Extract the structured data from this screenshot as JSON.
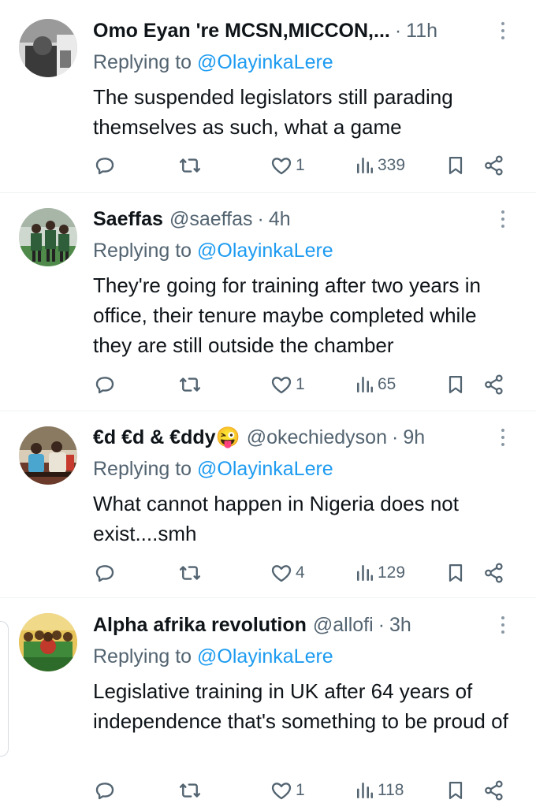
{
  "tweets": [
    {
      "name": "Omo Eyan 're MCSN,MICCON,...",
      "handle": "",
      "time": "11h",
      "reply_prefix": "Replying to ",
      "reply_to": "@OlayinkaLere",
      "text": "The suspended legislators still parading themselves as such, what a game",
      "likes": "1",
      "views": "339",
      "avatar": "grayscale-person-photo"
    },
    {
      "name": "Saeffas",
      "handle": "@saeffas",
      "time": "4h",
      "reply_prefix": "Replying to ",
      "reply_to": "@OlayinkaLere",
      "text": "They're going for training after two years in office, their tenure maybe completed while they are still outside the chamber",
      "likes": "1",
      "views": "65",
      "avatar": "football-players-photo"
    },
    {
      "name": "€d €d & €ddy😜",
      "handle": "@okechiedyson",
      "time": "9h",
      "reply_prefix": "Replying to ",
      "reply_to": "@OlayinkaLere",
      "text": "What cannot happen in Nigeria does not exist....smh",
      "likes": "4",
      "views": "129",
      "avatar": "group-photo"
    },
    {
      "name": "Alpha afrika revolution",
      "handle": "@allofi",
      "time": "3h",
      "reply_prefix": "Replying to ",
      "reply_to": "@OlayinkaLere",
      "text": "Legislative training in UK after 64 years of independence that's something to be proud of",
      "likes": "1",
      "views": "118",
      "avatar": "crowd-illustration"
    }
  ],
  "icons": {
    "reply": "reply-icon",
    "retweet": "retweet-icon",
    "like": "heart-icon",
    "views": "views-icon",
    "bookmark": "bookmark-icon",
    "share": "share-icon",
    "more": "more-dots-icon"
  },
  "colors": {
    "link": "#1d9bf0",
    "secondary_text": "#536471",
    "primary_text": "#0f1419",
    "divider": "#eff3f4"
  }
}
